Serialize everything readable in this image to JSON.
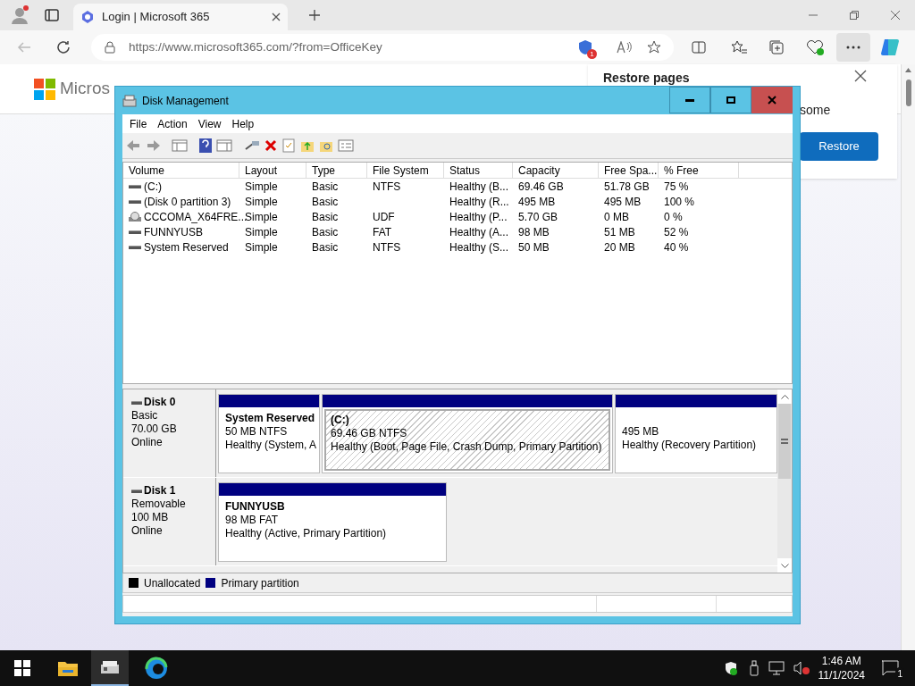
{
  "browser": {
    "tab_title": "Login | Microsoft 365",
    "url_host": "https://www.microsoft365.com",
    "url_path": "/?from=OfficeKey",
    "shield_badge": "1",
    "page": {
      "logo_text": "Micros",
      "restore_panel": {
        "title": "Restore pages",
        "text": "some",
        "button": "Restore"
      }
    }
  },
  "window": {
    "title": "Disk Management",
    "menu": [
      "File",
      "Action",
      "View",
      "Help"
    ],
    "volumes": {
      "columns": [
        "Volume",
        "Layout",
        "Type",
        "File System",
        "Status",
        "Capacity",
        "Free Spa...",
        "% Free"
      ],
      "rows": [
        {
          "kind": "disk",
          "cells": [
            "(C:)",
            "Simple",
            "Basic",
            "NTFS",
            "Healthy (B...",
            "69.46 GB",
            "51.78 GB",
            "75 %"
          ]
        },
        {
          "kind": "disk",
          "cells": [
            "(Disk 0 partition 3)",
            "Simple",
            "Basic",
            "",
            "Healthy (R...",
            "495 MB",
            "495 MB",
            "100 %"
          ]
        },
        {
          "kind": "cd",
          "cells": [
            "CCCOMA_X64FRE...",
            "Simple",
            "Basic",
            "UDF",
            "Healthy (P...",
            "5.70 GB",
            "0 MB",
            "0 %"
          ]
        },
        {
          "kind": "disk",
          "cells": [
            "FUNNYUSB",
            "Simple",
            "Basic",
            "FAT",
            "Healthy (A...",
            "98 MB",
            "51 MB",
            "52 %"
          ]
        },
        {
          "kind": "disk",
          "cells": [
            "System Reserved",
            "Simple",
            "Basic",
            "NTFS",
            "Healthy (S...",
            "50 MB",
            "20 MB",
            "40 %"
          ]
        }
      ]
    },
    "disks": [
      {
        "name": "Disk 0",
        "type": "Basic",
        "size": "70.00 GB",
        "status": "Online",
        "partitions": [
          {
            "label": "System Reserved",
            "detail": "50 MB NTFS",
            "health": "Healthy (System, A",
            "selected": false
          },
          {
            "label": "(C:)",
            "detail": "69.46 GB NTFS",
            "health": "Healthy (Boot, Page File, Crash Dump, Primary Partition)",
            "selected": true
          },
          {
            "detail": "495 MB",
            "health": "Healthy (Recovery Partition)",
            "selected": false
          }
        ]
      },
      {
        "name": "Disk 1",
        "type": "Removable",
        "size": "100 MB",
        "status": "Online",
        "partitions": [
          {
            "label": "FUNNYUSB",
            "detail": "98 MB FAT",
            "health": "Healthy (Active, Primary Partition)",
            "selected": false
          }
        ]
      }
    ],
    "legend": [
      {
        "label": "Unallocated",
        "color": "#000000"
      },
      {
        "label": "Primary partition",
        "color": "#000080"
      }
    ]
  },
  "taskbar": {
    "time": "1:46 AM",
    "date": "11/1/2024",
    "notification_count": "1"
  }
}
